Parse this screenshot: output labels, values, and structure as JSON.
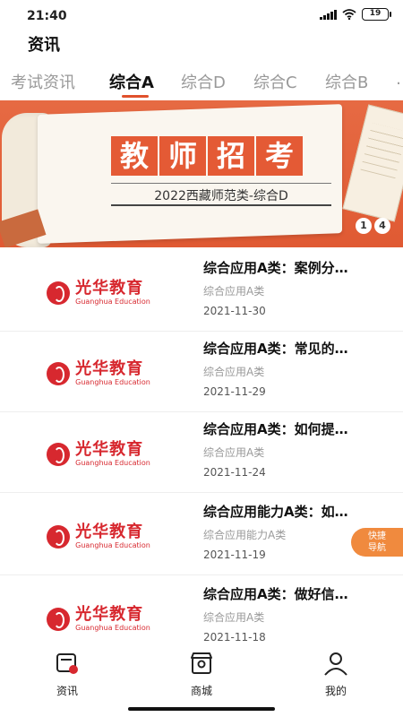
{
  "status_bar": {
    "time": "21:40",
    "battery": "19"
  },
  "header": {
    "title": "资讯"
  },
  "tabs": [
    {
      "label": "考试资讯",
      "active": false
    },
    {
      "label": "综合A",
      "active": true
    },
    {
      "label": "综合D",
      "active": false
    },
    {
      "label": "综合C",
      "active": false
    },
    {
      "label": "综合B",
      "active": false
    },
    {
      "label": "…",
      "active": false
    }
  ],
  "banner": {
    "title_chars": [
      "教",
      "师",
      "招",
      "考"
    ],
    "subtitle": "2022西藏师范类-综合D",
    "indicator_current": "1",
    "indicator_total": "4"
  },
  "news": [
    {
      "title": "综合应用A类：案例分…",
      "category": "综合应用A类",
      "date": "2021-11-30",
      "logo_cn": "光华教育",
      "logo_en": "Guanghua Education"
    },
    {
      "title": "综合应用A类：常见的…",
      "category": "综合应用A类",
      "date": "2021-11-29",
      "logo_cn": "光华教育",
      "logo_en": "Guanghua Education"
    },
    {
      "title": "综合应用A类：如何提…",
      "category": "综合应用A类",
      "date": "2021-11-24",
      "logo_cn": "光华教育",
      "logo_en": "Guanghua Education"
    },
    {
      "title": "综合应用能力A类：如…",
      "category": "综合应用能力A类",
      "date": "2021-11-19",
      "logo_cn": "光华教育",
      "logo_en": "Guanghua Education"
    },
    {
      "title": "综合应用A类：做好信…",
      "category": "综合应用A类",
      "date": "2021-11-18",
      "logo_cn": "光华教育",
      "logo_en": "Guanghua Education"
    }
  ],
  "quick_nav": {
    "line1": "快捷",
    "line2": "导航"
  },
  "bottom_nav": [
    {
      "label": "资讯",
      "icon": "news-icon",
      "active": true
    },
    {
      "label": "商城",
      "icon": "shop-icon",
      "active": false
    },
    {
      "label": "我的",
      "icon": "profile-icon",
      "active": false
    }
  ],
  "colors": {
    "accent": "#e0512c",
    "brand_red": "#d7282f",
    "banner_bg": "#e66a43",
    "quick_nav": "#f08a3e"
  }
}
